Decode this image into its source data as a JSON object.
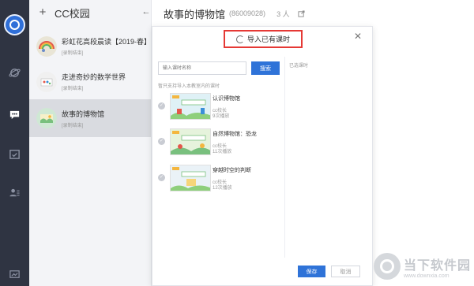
{
  "sidebar": {
    "title": "CC校园",
    "items": [
      {
        "name": "彩虹花高段晨读【2019-春】",
        "tag": "[录制结束]"
      },
      {
        "name": "走进奇妙的数学世界",
        "tag": "[录制结束]"
      },
      {
        "name": "故事的博物馆",
        "tag": "[录制结束]"
      }
    ]
  },
  "header": {
    "title": "故事的博物馆",
    "room_id": "(86009028)",
    "member_count": "3 人"
  },
  "modal": {
    "title": "导入已有课时",
    "search_placeholder": "输入课时名称",
    "search_label": "搜索",
    "hint": "暂只支持导入本教室内的课时",
    "selected_label": "已选课时",
    "save_label": "保存",
    "cancel_label": "取消",
    "courses": [
      {
        "title": "认识博物馆",
        "author": "cc校长",
        "plays": "9次播放"
      },
      {
        "title": "自然博物馆：恐龙",
        "author": "cc校长",
        "plays": "11次播放"
      },
      {
        "title": "穿越时空的判断",
        "author": "cc校长",
        "plays": "12次播放"
      }
    ]
  },
  "watermark": {
    "text": "当下软件园",
    "url": "www.downxia.com"
  },
  "colors": {
    "accent": "#2f73d8",
    "rail": "#2f3442",
    "highlight_box": "#e53935"
  }
}
